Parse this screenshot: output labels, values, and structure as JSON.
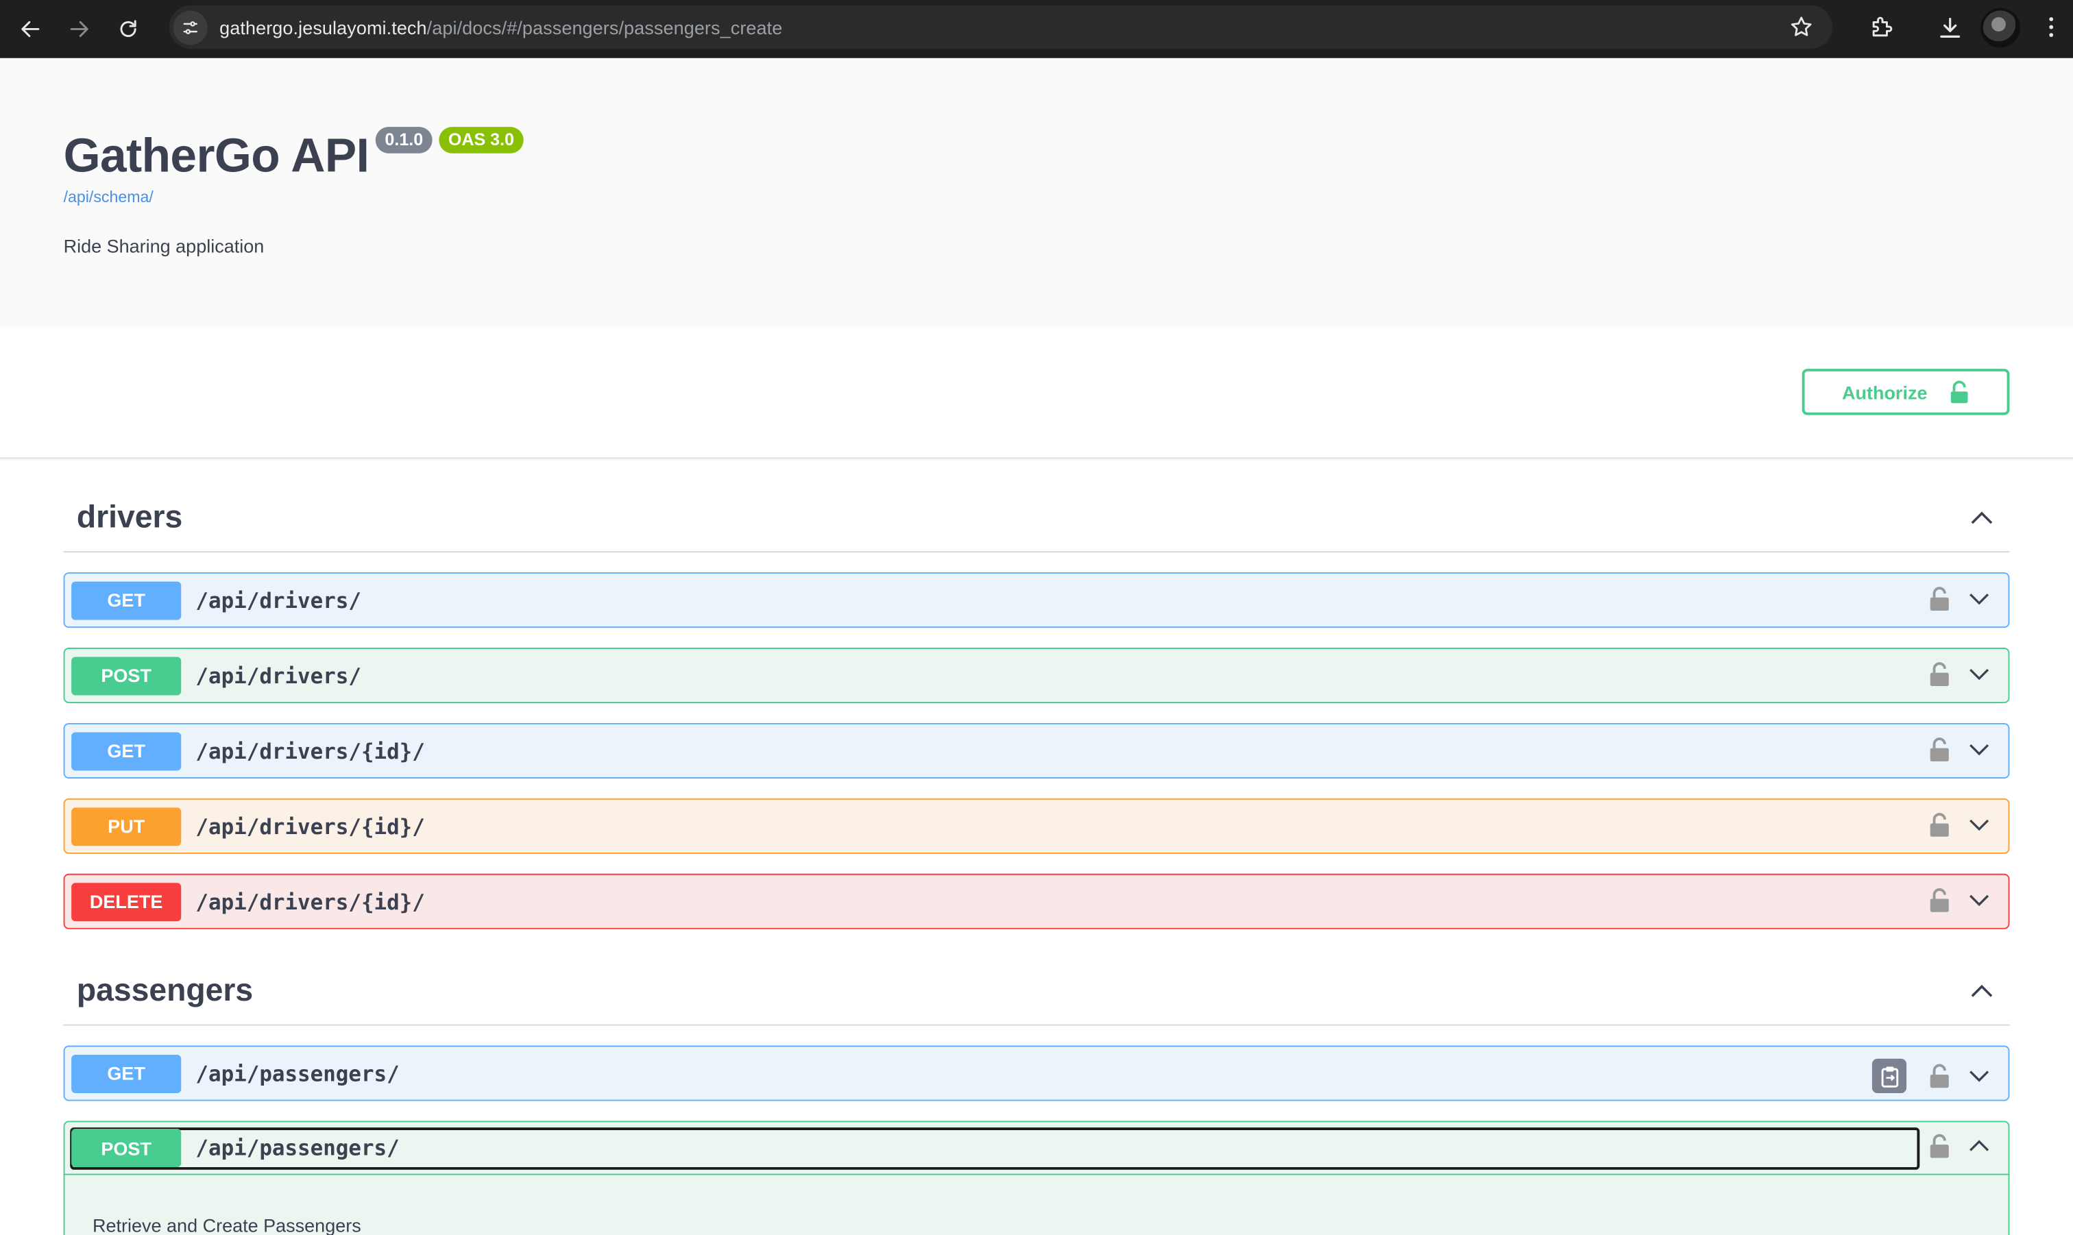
{
  "browser": {
    "url_host": "gathergo.jesulayomi.tech",
    "url_path": "/api/docs/#/passengers/passengers_create"
  },
  "info": {
    "title": "GatherGo API",
    "version_badge": "0.1.0",
    "oas_badge": "OAS 3.0",
    "schema_link": "/api/schema/",
    "description": "Ride Sharing application"
  },
  "authorize": {
    "label": "Authorize"
  },
  "colors": {
    "get": "#61affe",
    "post": "#49cc90",
    "put": "#fca130",
    "delete": "#f93e3e"
  },
  "sections": [
    {
      "name": "drivers",
      "operations": [
        {
          "method": "GET",
          "path": "/api/drivers/"
        },
        {
          "method": "POST",
          "path": "/api/drivers/"
        },
        {
          "method": "GET",
          "path": "/api/drivers/{id}/"
        },
        {
          "method": "PUT",
          "path": "/api/drivers/{id}/"
        },
        {
          "method": "DELETE",
          "path": "/api/drivers/{id}/"
        }
      ]
    },
    {
      "name": "passengers",
      "operations": [
        {
          "method": "GET",
          "path": "/api/passengers/"
        },
        {
          "method": "POST",
          "path": "/api/passengers/",
          "expanded": true,
          "description": "Retrieve and Create Passengers"
        }
      ]
    }
  ]
}
